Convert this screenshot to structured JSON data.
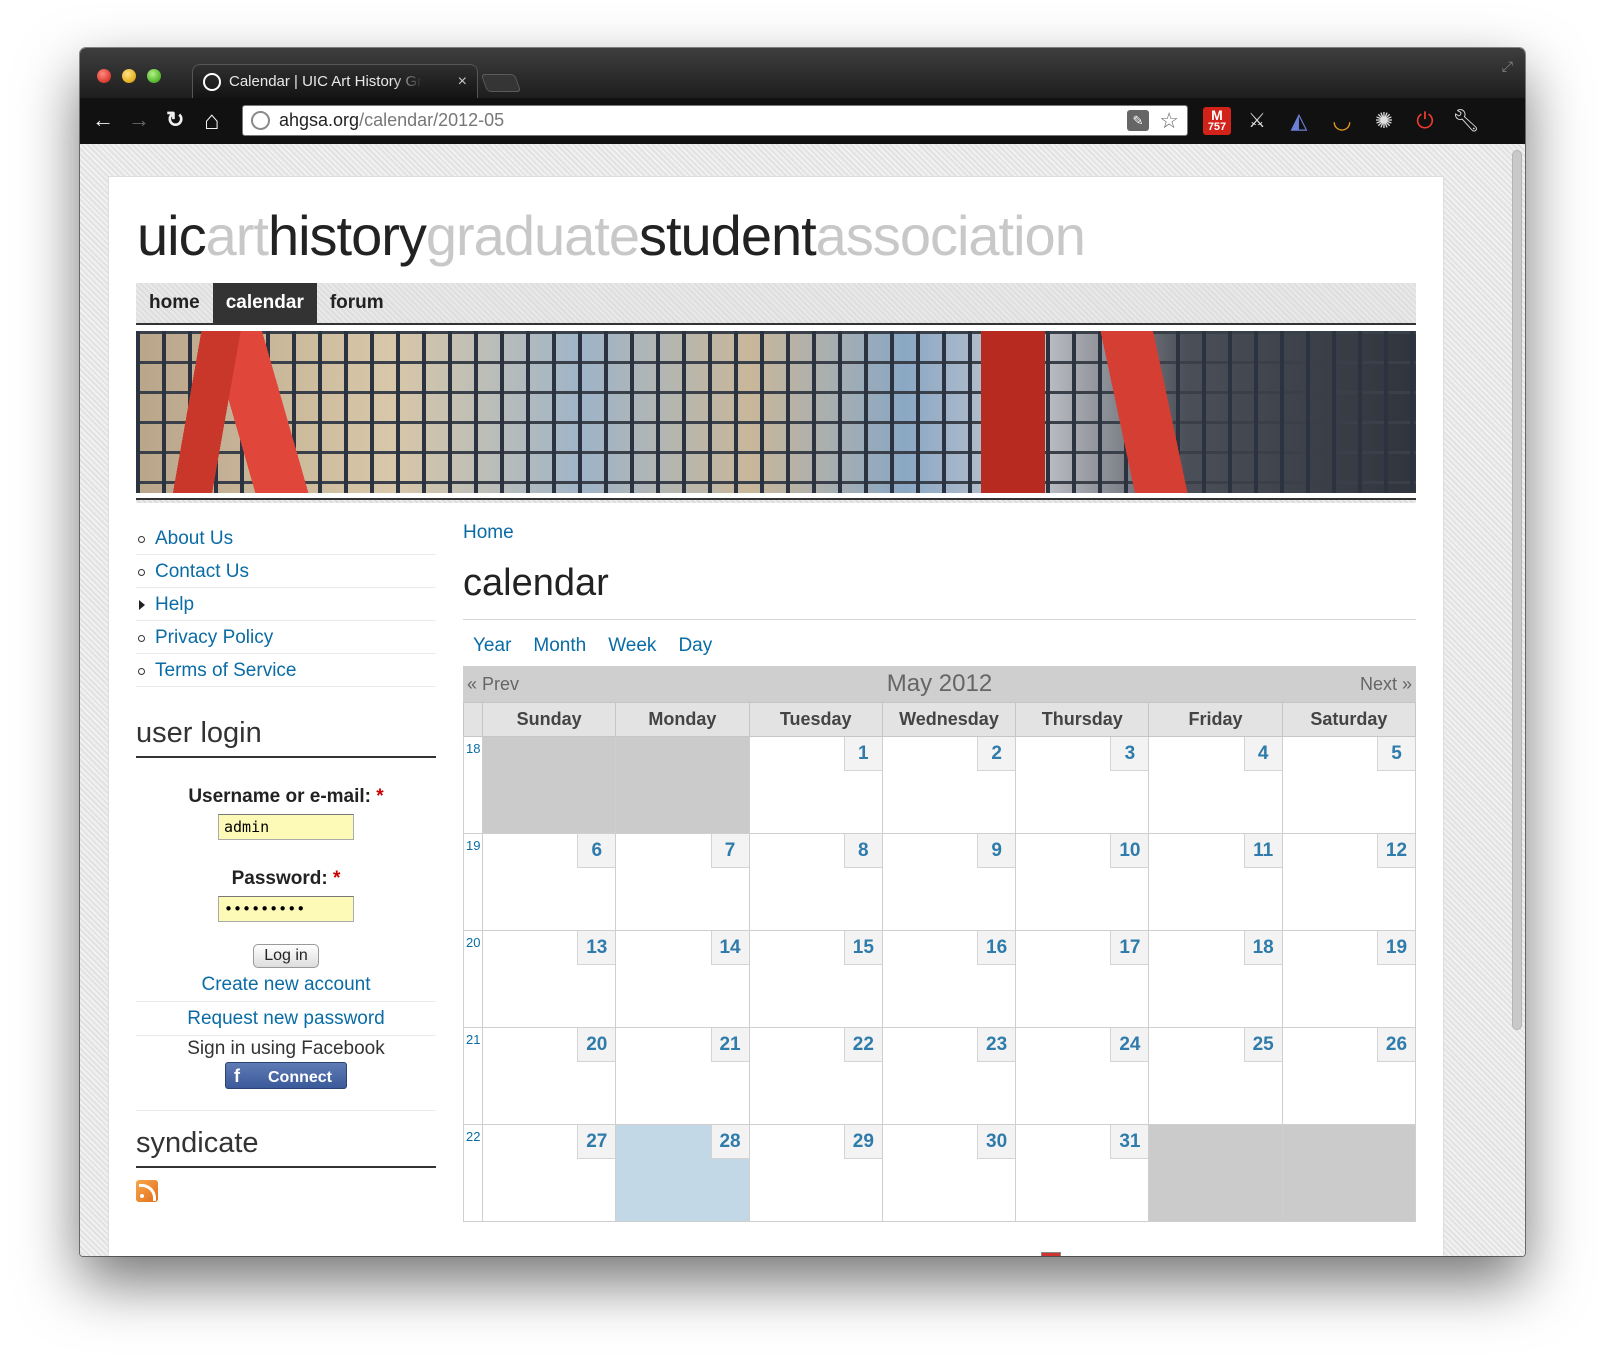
{
  "browser": {
    "tab_title": "Calendar | UIC Art History Gr",
    "tab_close": "×",
    "url_domain": "ahgsa.org",
    "url_path": "/calendar/2012-05",
    "back": "←",
    "forward": "→",
    "reload": "↻",
    "home": "⌂",
    "star": "☆",
    "gmail_badge_letter": "M",
    "gmail_badge_count": "757",
    "extensions": [
      "sword-icon",
      "radar-icon",
      "amazon-icon",
      "gear-icon",
      "stop-icon",
      "wrench-icon"
    ]
  },
  "site": {
    "title_parts": [
      {
        "text": "uic",
        "style": "dark"
      },
      {
        "text": "art",
        "style": "light"
      },
      {
        "text": "history",
        "style": "dark"
      },
      {
        "text": "graduate",
        "style": "light"
      },
      {
        "text": "student",
        "style": "dark"
      },
      {
        "text": "association",
        "style": "light"
      }
    ],
    "nav": [
      {
        "label": "home",
        "active": false
      },
      {
        "label": "calendar",
        "active": true
      },
      {
        "label": "forum",
        "active": false
      }
    ]
  },
  "sidebar": {
    "menu": [
      {
        "label": "About Us",
        "bullet": "circle"
      },
      {
        "label": "Contact Us",
        "bullet": "circle"
      },
      {
        "label": "Help",
        "bullet": "triangle"
      },
      {
        "label": "Privacy Policy",
        "bullet": "circle"
      },
      {
        "label": "Terms of Service",
        "bullet": "circle"
      }
    ],
    "login": {
      "title": "user login",
      "username_label": "Username or e-mail:",
      "username_value": "admin",
      "password_label": "Password:",
      "password_value": "•••••••••",
      "required_mark": "*",
      "submit": "Log in",
      "links": [
        "Create new account",
        "Request new password"
      ],
      "facebook_text": "Sign in using Facebook",
      "facebook_button": "Connect",
      "facebook_f": "f"
    },
    "syndicate": {
      "title": "syndicate"
    }
  },
  "main": {
    "breadcrumb": "Home",
    "title": "calendar",
    "view_tabs": [
      "Year",
      "Month",
      "Week",
      "Day"
    ],
    "calendar": {
      "prev": "« Prev",
      "next": "Next »",
      "month": "May 2012",
      "weekdays": [
        "Sunday",
        "Monday",
        "Tuesday",
        "Wednesday",
        "Thursday",
        "Friday",
        "Saturday"
      ],
      "weeks": [
        {
          "number": "18",
          "days": [
            "",
            "",
            "1",
            "2",
            "3",
            "4",
            "5"
          ]
        },
        {
          "number": "19",
          "days": [
            "6",
            "7",
            "8",
            "9",
            "10",
            "11",
            "12"
          ]
        },
        {
          "number": "20",
          "days": [
            "13",
            "14",
            "15",
            "16",
            "17",
            "18",
            "19"
          ]
        },
        {
          "number": "21",
          "days": [
            "20",
            "21",
            "22",
            "23",
            "24",
            "25",
            "26"
          ]
        },
        {
          "number": "22",
          "days": [
            "27",
            "28",
            "29",
            "30",
            "31",
            "",
            ""
          ]
        }
      ],
      "today": "28"
    }
  },
  "colors": {
    "link": "#0a6ca5",
    "day_number": "#2f7bab",
    "today_bg": "#c2d8e7",
    "empty_bg": "#cbcbcb",
    "nav_active_bg": "#333333"
  }
}
